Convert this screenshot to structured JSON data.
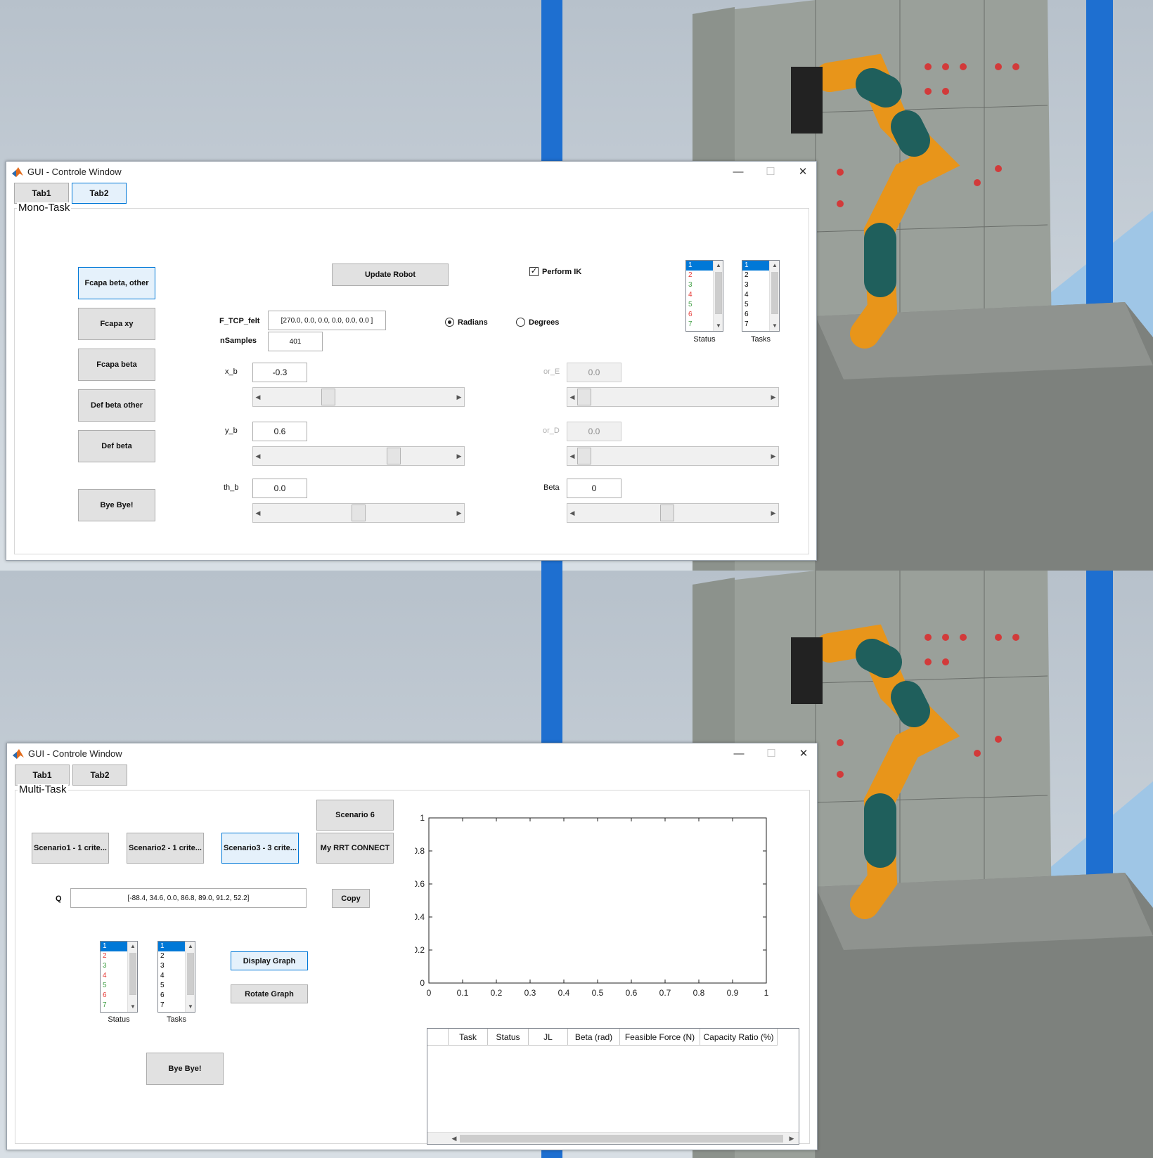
{
  "top_window": {
    "title": "GUI - Controle Window",
    "controls": {
      "minimize": "—",
      "maximize": "☐",
      "close": "✕"
    },
    "tabs": [
      {
        "label": "Tab1"
      },
      {
        "label": "Tab2"
      }
    ],
    "panel_title": "Mono-Task",
    "left_buttons": [
      {
        "label": "Fcapa beta, other"
      },
      {
        "label": "Fcapa xy"
      },
      {
        "label": "Fcapa beta"
      },
      {
        "label": "Def beta other"
      },
      {
        "label": "Def beta"
      },
      {
        "label": "Bye Bye!"
      }
    ],
    "update_robot": "Update Robot",
    "perform_ik": {
      "label": "Perform IK",
      "checked": true
    },
    "f_tcp": {
      "label": "F_TCP_felt",
      "value": "[270.0, 0.0, 0.0, 0.0, 0.0, 0.0 ]"
    },
    "nsamples": {
      "label": "nSamples",
      "value": "401"
    },
    "radians": "Radians",
    "degrees": "Degrees",
    "angle_unit_selected": "Radians",
    "sliders": [
      {
        "label": "x_b",
        "value": "-0.3",
        "level": 0.33,
        "enabled": true
      },
      {
        "label": "or_E",
        "value": "0.0",
        "level": 0.0,
        "enabled": false
      },
      {
        "label": "y_b",
        "value": "0.6",
        "level": 0.7,
        "enabled": true
      },
      {
        "label": "or_D",
        "value": "0.0",
        "level": 0.0,
        "enabled": false
      },
      {
        "label": "th_b",
        "value": "0.0",
        "level": 0.5,
        "enabled": true
      },
      {
        "label": "Beta",
        "value": "0",
        "level": 0.47,
        "enabled": true
      }
    ],
    "status_list": {
      "caption": "Status",
      "items": [
        "1",
        "2",
        "3",
        "4",
        "5",
        "6",
        "7"
      ]
    },
    "tasks_list": {
      "caption": "Tasks",
      "items": [
        "1",
        "2",
        "3",
        "4",
        "5",
        "6",
        "7"
      ]
    }
  },
  "bottom_window": {
    "title": "GUI - Controle Window",
    "controls": {
      "minimize": "—",
      "maximize": "☐",
      "close": "✕"
    },
    "tabs": [
      {
        "label": "Tab1"
      },
      {
        "label": "Tab2"
      }
    ],
    "panel_title": "Multi-Task",
    "scenario6": "Scenario 6",
    "scenarios": [
      {
        "label": "Scenario1 - 1 crite..."
      },
      {
        "label": "Scenario2 - 1 crite..."
      },
      {
        "label": "Scenario3 - 3 crite..."
      }
    ],
    "my_rrt": "My RRT CONNECT",
    "q": {
      "label": "Q",
      "value": "[-88.4, 34.6, 0.0, 86.8, 89.0, 91.2, 52.2]"
    },
    "copy": "Copy",
    "status_list": {
      "caption": "Status",
      "items": [
        "1",
        "2",
        "3",
        "4",
        "5",
        "6",
        "7"
      ]
    },
    "tasks_list": {
      "caption": "Tasks",
      "items": [
        "1",
        "2",
        "3",
        "4",
        "5",
        "6",
        "7"
      ]
    },
    "display_graph": "Display Graph",
    "rotate_graph": "Rotate Graph",
    "bye": "Bye Bye!",
    "table_headers": [
      "",
      "Task",
      "Status",
      "JL",
      "Beta (rad)",
      "Feasible Force (N)",
      "Capacity Ratio (%)"
    ]
  },
  "chart_data": {
    "type": "line",
    "title": "",
    "xlabel": "",
    "ylabel": "",
    "xlim": [
      0,
      1
    ],
    "ylim": [
      0,
      1
    ],
    "x_ticks": [
      "0",
      "0.1",
      "0.2",
      "0.3",
      "0.4",
      "0.5",
      "0.6",
      "0.7",
      "0.8",
      "0.9",
      "1"
    ],
    "y_ticks": [
      "0",
      "0.2",
      "0.4",
      "0.6",
      "0.8",
      "1"
    ],
    "series": []
  },
  "colors": {
    "sky_top": "#b8c2cc",
    "sky_bottom": "#d6dde3",
    "floor": "#9fc6e6",
    "frame_blue": "#1e6fd0",
    "wall": "#9aa09a",
    "base": "#7d817d",
    "robot_orange": "#e8951a",
    "robot_teal": "#1f5f5c",
    "list_odd": "#e53935",
    "list_even": "#43a047",
    "selection": "#0078d7"
  }
}
